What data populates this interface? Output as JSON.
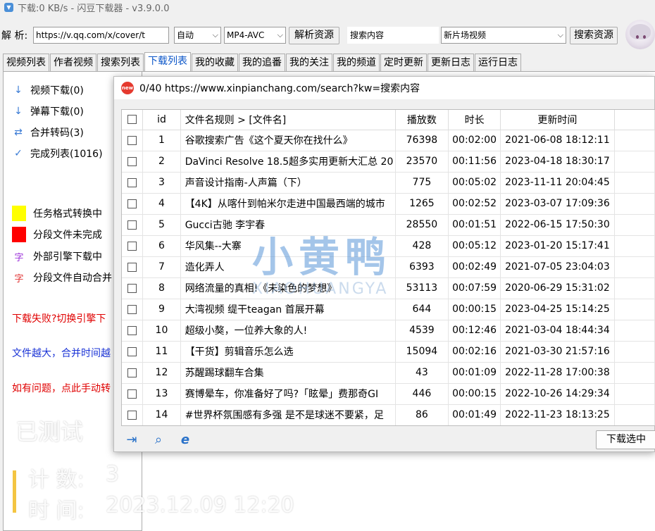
{
  "window": {
    "title": "下载:0 KB/s - 闪豆下载器 - v3.9.0.0"
  },
  "toolbar": {
    "parse_label": "解 析:",
    "url_value": "https://v.qq.com/x/cover/t",
    "mode_select": "自动",
    "format_select": "MP4-AVC",
    "parse_button": "解析资源",
    "search_value": "搜索内容",
    "site_select": "新片场视频",
    "search_button": "搜索资源"
  },
  "tabs": [
    "视频列表",
    "作者视频",
    "搜索列表",
    "下载列表",
    "我的收藏",
    "我的追番",
    "我的关注",
    "我的频道",
    "定时更新",
    "更新日志",
    "运行日志"
  ],
  "sidebar": {
    "items": [
      {
        "label": "视频下载(0)",
        "icon": "arrow-down-icon"
      },
      {
        "label": "弹幕下载(0)",
        "icon": "arrow-down-icon"
      },
      {
        "label": "合并转码(3)",
        "icon": "swap-icon"
      },
      {
        "label": "完成列表(1016)",
        "icon": "check-icon"
      }
    ],
    "legend": [
      {
        "label": "任务格式转换中",
        "color": "#ffff00"
      },
      {
        "label": "分段文件未完成",
        "color": "#ff0000"
      },
      {
        "label": "外部引擎下载中",
        "glyph": "字",
        "color": "#9b30d9"
      },
      {
        "label": "分段文件自动合并",
        "glyph": "字",
        "color": "#e03030"
      }
    ],
    "notes": [
      {
        "text": "下载失败?切换引擎下",
        "color": "#e00000"
      },
      {
        "text": "文件越大，合并时间越",
        "color": "#1a33d6"
      },
      {
        "text": "如有问题，点此手动转",
        "color": "#e00000"
      }
    ]
  },
  "overlay": {
    "tested": "已测试",
    "count_label": "计  数:",
    "count_value": "3",
    "time_label": "时  间:",
    "time_value": "2023.12.09 12:20"
  },
  "dialog": {
    "title": "0/40 https://www.xinpianchang.com/search?kw=搜索内容",
    "columns": [
      "id",
      "文件名规则  >  [文件名]",
      "播放数",
      "时长",
      "更新时间"
    ],
    "rows": [
      {
        "id": "1",
        "name": "谷歌搜索广告《这个夏天你在找什么》",
        "plays": "76398",
        "duration": "00:02:00",
        "updated": "2021-06-08 18:12:11"
      },
      {
        "id": "2",
        "name": "DaVinci Resolve 18.5超多实用更新大汇总 20",
        "plays": "23570",
        "duration": "00:11:56",
        "updated": "2023-04-18 18:30:17"
      },
      {
        "id": "3",
        "name": "声音设计指南-人声篇（下）",
        "plays": "775",
        "duration": "00:05:02",
        "updated": "2023-11-11 20:04:45"
      },
      {
        "id": "4",
        "name": "【4K】从喀什到帕米尔走进中国最西端的城市",
        "plays": "1265",
        "duration": "00:02:52",
        "updated": "2023-03-07 17:09:36"
      },
      {
        "id": "5",
        "name": "Gucci古驰  李宇春",
        "plays": "28550",
        "duration": "00:01:51",
        "updated": "2022-06-15 17:50:30"
      },
      {
        "id": "6",
        "name": "华风集--大寨",
        "plays": "428",
        "duration": "00:05:12",
        "updated": "2023-01-20 15:17:41"
      },
      {
        "id": "7",
        "name": "造化弄人",
        "plays": "6393",
        "duration": "00:02:49",
        "updated": "2021-07-05 23:04:03"
      },
      {
        "id": "8",
        "name": "网络流量的真相!《未染色的梦想》",
        "plays": "53113",
        "duration": "00:07:59",
        "updated": "2020-06-29 15:31:02"
      },
      {
        "id": "9",
        "name": "大湾视频  缇干teagan 首展开幕",
        "plays": "644",
        "duration": "00:00:15",
        "updated": "2023-04-25 15:14:25"
      },
      {
        "id": "10",
        "name": "超级小獒，一位养大象的人!",
        "plays": "4539",
        "duration": "00:12:46",
        "updated": "2021-03-04 18:44:34"
      },
      {
        "id": "11",
        "name": "【干货】剪辑音乐怎么选",
        "plays": "15094",
        "duration": "00:02:16",
        "updated": "2021-03-30 21:57:16"
      },
      {
        "id": "12",
        "name": "苏醒踢球翻车合集",
        "plays": "43",
        "duration": "00:01:09",
        "updated": "2022-11-28 17:00:38"
      },
      {
        "id": "13",
        "name": "赛博晕车，你准备好了吗?「眩晕」费那奇GI",
        "plays": "446",
        "duration": "00:00:15",
        "updated": "2022-10-26 14:29:34"
      },
      {
        "id": "14",
        "name": "#世界杯氛围感有多强 是不是球迷不要紧，足",
        "plays": "86",
        "duration": "00:01:49",
        "updated": "2022-11-23 18:13:25"
      }
    ],
    "footer_icons": [
      "export-list-icon",
      "search-list-icon",
      "ie-browser-icon"
    ],
    "download_button": "下载选中"
  },
  "watermark": {
    "main": "小黄鸭",
    "sub": "XIAOHUANGYA"
  }
}
